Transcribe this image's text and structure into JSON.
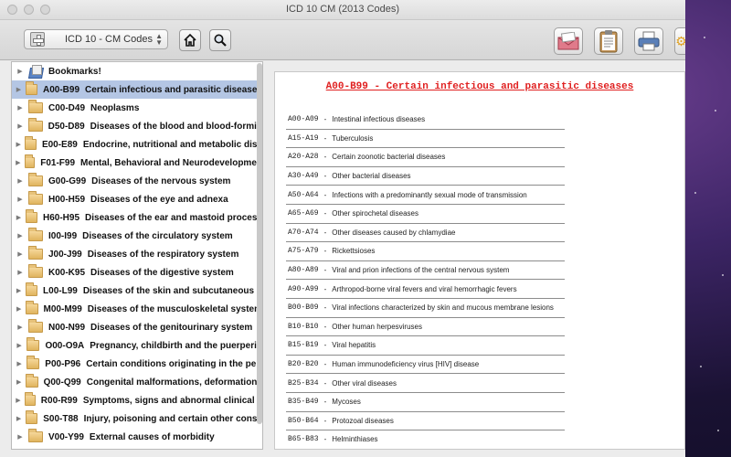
{
  "window": {
    "title": "ICD 10 CM (2013 Codes)"
  },
  "toolbar": {
    "selector_label": "ICD 10 - CM Codes",
    "icons": [
      "home-icon",
      "search-icon",
      "mail-icon",
      "clipboard-icon",
      "print-icon"
    ]
  },
  "sidebar": {
    "bookmarks_label": "Bookmarks!",
    "items": [
      {
        "code": "A00-B99",
        "name": "Certain infectious and parasitic diseases"
      },
      {
        "code": "C00-D49",
        "name": "Neoplasms"
      },
      {
        "code": "D50-D89",
        "name": "Diseases of the blood and blood-formin"
      },
      {
        "code": "E00-E89",
        "name": "Endocrine, nutritional and metabolic dise"
      },
      {
        "code": "F01-F99",
        "name": "Mental, Behavioral and Neurodevelopmen"
      },
      {
        "code": "G00-G99",
        "name": "Diseases of the nervous system"
      },
      {
        "code": "H00-H59",
        "name": "Diseases of the eye and adnexa"
      },
      {
        "code": "H60-H95",
        "name": "Diseases of the ear and mastoid process"
      },
      {
        "code": "I00-I99",
        "name": "Diseases of the circulatory system"
      },
      {
        "code": "J00-J99",
        "name": "Diseases of the respiratory system"
      },
      {
        "code": "K00-K95",
        "name": "Diseases of the digestive system"
      },
      {
        "code": "L00-L99",
        "name": "Diseases of the skin and subcutaneous ti"
      },
      {
        "code": "M00-M99",
        "name": "Diseases of the musculoskeletal system"
      },
      {
        "code": "N00-N99",
        "name": "Diseases of the genitourinary system"
      },
      {
        "code": "O00-O9A",
        "name": "Pregnancy, childbirth and the puerperiu"
      },
      {
        "code": "P00-P96",
        "name": "Certain conditions originating in the peri"
      },
      {
        "code": "Q00-Q99",
        "name": "Congenital malformations, deformations"
      },
      {
        "code": "R00-R99",
        "name": "Symptoms, signs and abnormal clinical a"
      },
      {
        "code": "S00-T88",
        "name": "Injury, poisoning and certain other conse"
      },
      {
        "code": "V00-Y99",
        "name": "External causes of morbidity"
      }
    ]
  },
  "content": {
    "heading": "A00-B99 - Certain infectious and parasitic diseases",
    "heading_color": "#e02020",
    "dash": "-",
    "entries": [
      {
        "code": "A00-A09",
        "name": "Intestinal infectious diseases"
      },
      {
        "code": "A15-A19",
        "name": "Tuberculosis"
      },
      {
        "code": "A20-A28",
        "name": "Certain zoonotic bacterial diseases"
      },
      {
        "code": "A30-A49",
        "name": "Other bacterial diseases"
      },
      {
        "code": "A50-A64",
        "name": "Infections with a predominantly sexual mode of transmission"
      },
      {
        "code": "A65-A69",
        "name": "Other spirochetal diseases"
      },
      {
        "code": "A70-A74",
        "name": "Other diseases caused by chlamydiae"
      },
      {
        "code": "A75-A79",
        "name": "Rickettsioses"
      },
      {
        "code": "A80-A89",
        "name": "Viral and prion infections of the central nervous system"
      },
      {
        "code": "A90-A99",
        "name": "Arthropod-borne viral fevers and viral hemorrhagic fevers"
      },
      {
        "code": "B00-B09",
        "name": "Viral infections characterized by skin and mucous membrane lesions"
      },
      {
        "code": "B10-B10",
        "name": "Other human herpesviruses"
      },
      {
        "code": "B15-B19",
        "name": "Viral hepatitis"
      },
      {
        "code": "B20-B20",
        "name": "Human immunodeficiency virus [HIV] disease"
      },
      {
        "code": "B25-B34",
        "name": "Other viral diseases"
      },
      {
        "code": "B35-B49",
        "name": "Mycoses"
      },
      {
        "code": "B50-B64",
        "name": "Protozoal diseases"
      },
      {
        "code": "B65-B83",
        "name": "Helminthiases"
      }
    ]
  }
}
